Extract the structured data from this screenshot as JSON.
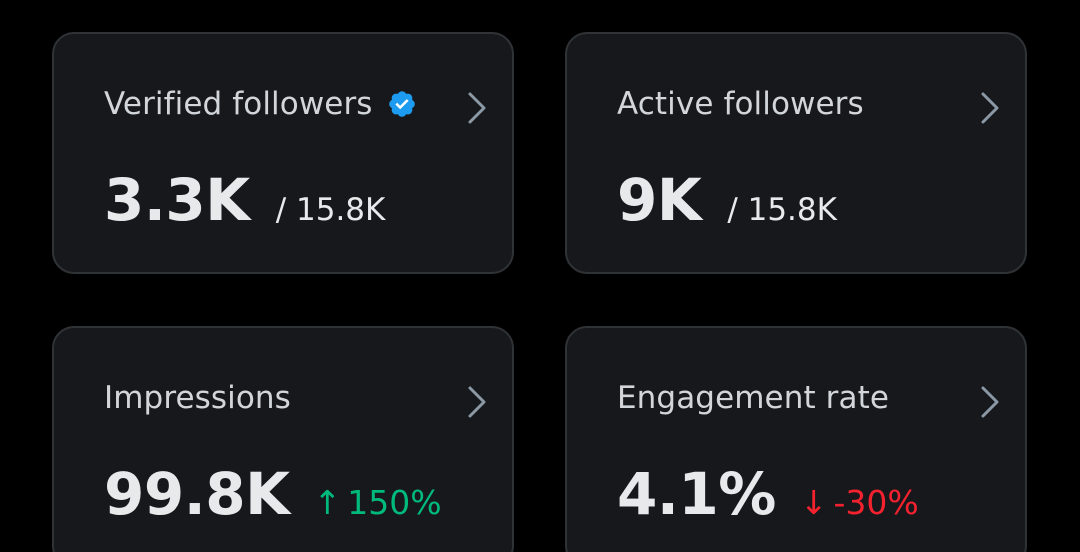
{
  "cards": [
    {
      "title": "Verified followers",
      "value": "3.3K",
      "sub": "/ 15.8K",
      "icon": "verified-badge-icon",
      "icon_color": "#1d9bf0"
    },
    {
      "title": "Active followers",
      "value": "9K",
      "sub": "/ 15.8K"
    },
    {
      "title": "Impressions",
      "value": "99.8K",
      "delta_arrow": "↑",
      "delta": "150%",
      "delta_color": "#00ba7c"
    },
    {
      "title": "Engagement rate",
      "value": "4.1%",
      "delta_arrow": "↓",
      "delta": "-30%",
      "delta_color": "#f4212e"
    }
  ],
  "colors": {
    "background": "#000000",
    "card_bg": "#16181c",
    "card_border": "#2f3336",
    "text_primary": "#e7e9ea",
    "text_secondary": "#d2d6da",
    "chevron": "#8b98a5"
  }
}
